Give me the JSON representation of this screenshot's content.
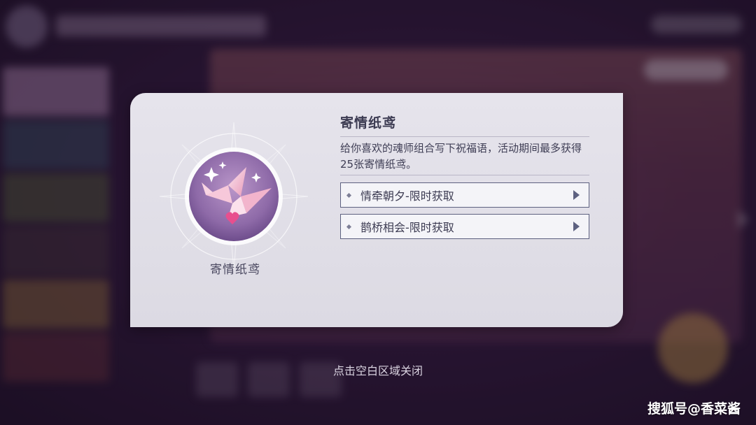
{
  "popup": {
    "item_name": "寄情纸鸢",
    "title": "寄情纸鸢",
    "description": "给你喜欢的魂师组合写下祝福语，活动期间最多获得25张寄情纸鸢。",
    "sources": [
      {
        "label": "情牵朝夕-限时获取"
      },
      {
        "label": "鹊桥相会-限时获取"
      }
    ],
    "icon": "paper-crane-icon"
  },
  "close_hint": "点击空白区域关闭",
  "watermark": "搜狐号@香菜酱",
  "colors": {
    "panel_bg": "#e2e0e8",
    "title": "#3c3b52",
    "source_border": "#5d6180",
    "icon_circle": "#8e6aa8"
  }
}
